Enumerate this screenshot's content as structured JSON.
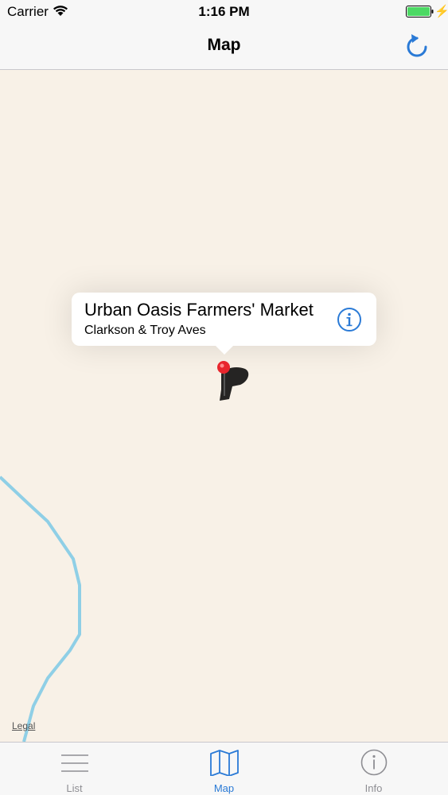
{
  "status_bar": {
    "carrier": "Carrier",
    "time": "1:16 PM",
    "battery_color": "#4cd964"
  },
  "nav_bar": {
    "title": "Map",
    "refresh_icon": "refresh-icon"
  },
  "map": {
    "callout": {
      "title": "Urban Oasis Farmers' Market",
      "subtitle": "Clarkson & Troy Aves",
      "info_icon": "info-icon"
    },
    "pin_color": "#e8262d",
    "road_color": "#8fcfe6",
    "legal_label": "Legal"
  },
  "tab_bar": {
    "accent_color": "#2a7ad6",
    "tabs": [
      {
        "label": "List",
        "icon": "list-icon",
        "selected": false
      },
      {
        "label": "Map",
        "icon": "map-icon",
        "selected": true
      },
      {
        "label": "Info",
        "icon": "info-icon",
        "selected": false
      }
    ]
  }
}
